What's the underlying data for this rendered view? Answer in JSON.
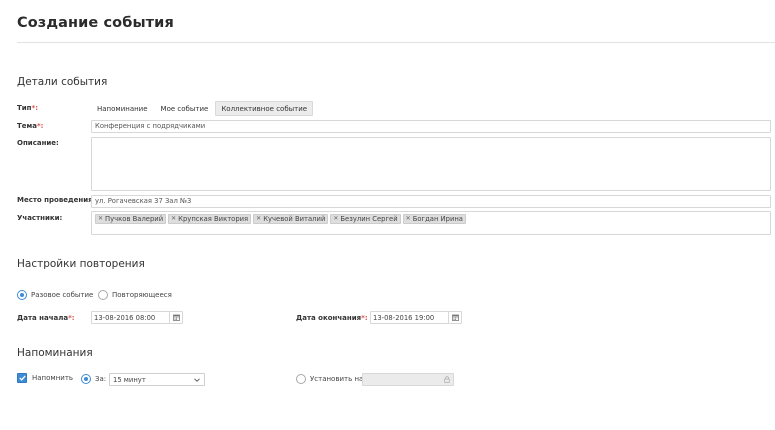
{
  "page": {
    "title": "Создание события"
  },
  "details": {
    "section_title": "Детали события",
    "type": {
      "label": "Тип",
      "required_mark": "*:",
      "options": [
        "Напоминание",
        "Мое событие",
        "Коллективное событие"
      ],
      "selected": "Коллективное событие"
    },
    "topic": {
      "label": "Тема",
      "required_mark": "*:",
      "value": "Конференция с подрядчиками"
    },
    "description": {
      "label": "Описание:",
      "value": ""
    },
    "location": {
      "label": "Место проведения:",
      "value": "ул. Рогачевская 37 Зал №3"
    },
    "participants": {
      "label": "Участники:",
      "tags": [
        "Пучков Валерий",
        "Крупская Виктория",
        "Кучевой Виталий",
        "Безулин Сергей",
        "Богдан Ирина"
      ]
    }
  },
  "repeat": {
    "section_title": "Настройки повторения",
    "options": [
      {
        "label": "Разовое событие",
        "checked": true
      },
      {
        "label": "Повторяющееся",
        "checked": false
      }
    ],
    "start": {
      "label": "Дата начала",
      "required_mark": "*:",
      "value": "13-08-2016 08:00",
      "icon": "calendar-icon"
    },
    "end": {
      "label": "Дата окончания",
      "required_mark": "*:",
      "value": "13-08-2016 19:00",
      "icon": "calendar-icon"
    }
  },
  "reminders": {
    "section_title": "Напоминания",
    "remind": {
      "label": "Напомнить",
      "checked": true
    },
    "before": {
      "label": "За:",
      "checked": true,
      "selected_value": "15 минут",
      "icon": "chevron-down-icon"
    },
    "set_at": {
      "label": "Установить на:",
      "checked": false,
      "value": "",
      "icon": "lock-icon"
    }
  },
  "colors": {
    "accent": "#3d8bd4",
    "required": "#d9534f",
    "tag_bg": "#dedede",
    "active_seg_bg": "#ececec"
  }
}
